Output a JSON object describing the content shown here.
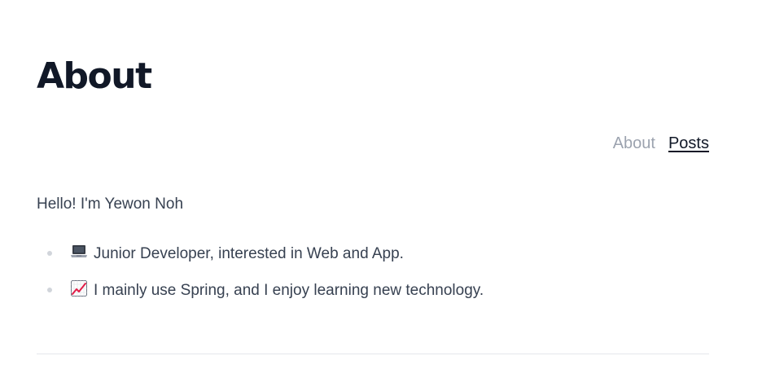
{
  "header": {
    "title": "About"
  },
  "nav": {
    "items": [
      {
        "label": "About"
      },
      {
        "label": "Posts"
      }
    ]
  },
  "content": {
    "intro": "Hello! I'm Yewon Noh",
    "list": [
      {
        "icon": "laptop-icon",
        "text": "Junior Developer, interested in Web and App."
      },
      {
        "icon": "chart-increasing-icon",
        "text": "I mainly use Spring, and I enjoy learning new technology."
      }
    ]
  },
  "colors": {
    "title": "#111827",
    "text": "#374151",
    "nav_inactive": "#9ca3af",
    "bullet": "#d1d5db",
    "divider": "#e5e7eb"
  }
}
